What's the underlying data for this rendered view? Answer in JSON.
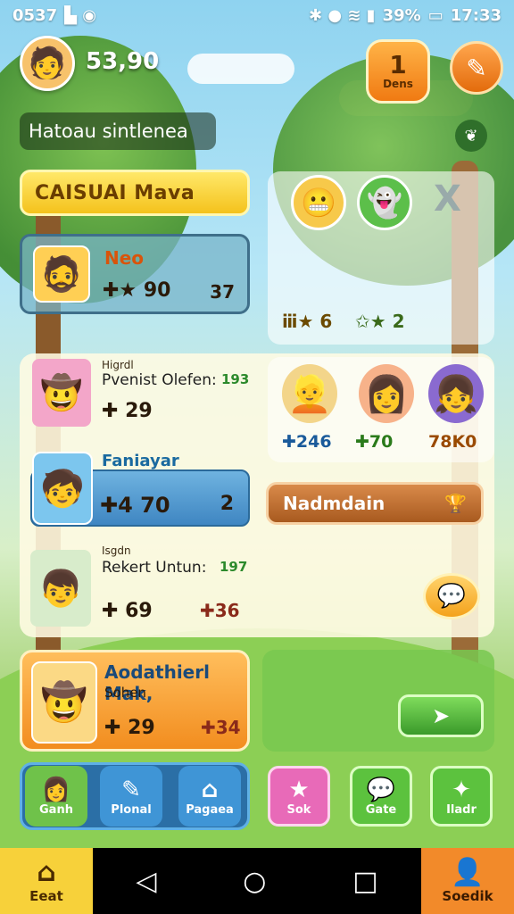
{
  "status_bar": {
    "time_left": "0537",
    "right_icons": "✱ ● ≋ ▮",
    "battery": "39%",
    "clock": "17:33"
  },
  "header": {
    "coins": "53,90",
    "badge_number": "1",
    "badge_label": "Dens",
    "banner": "Hatoau sintlenea"
  },
  "section": {
    "title": "CAISUAI Mava"
  },
  "card_a": {
    "name": "Neo",
    "score": "✚★ 90",
    "rank": "37"
  },
  "panel_r1": {
    "stat1": "ⅲ★ 6",
    "stat2": "✩★ 2",
    "close": "X"
  },
  "row_b": {
    "tag": "Higrdl",
    "title": "Pvenist Olefen:",
    "level": "193",
    "score": "✚ 29"
  },
  "characters": [
    {
      "score": "✚246"
    },
    {
      "score": "✚70"
    },
    {
      "score": "78K0"
    }
  ],
  "card_c": {
    "header": "Faniayar",
    "score": "✚4 70",
    "rank": "2"
  },
  "action_bar": {
    "label": "Nadmdain"
  },
  "row_d": {
    "tag": "Isgdn",
    "title": "Rekert Untun:",
    "level": "197",
    "score": "✚ 69",
    "score2": "✚36"
  },
  "card_e": {
    "title": "Aodathierl Mak,",
    "sub": "Sohen",
    "score": "✚ 29",
    "score2": "✚34"
  },
  "nav": [
    {
      "label": "Ganh"
    },
    {
      "label": "Plonal"
    },
    {
      "label": "Pagaea"
    },
    {
      "label": "Sok"
    },
    {
      "label": "Gate"
    },
    {
      "label": "Iladr"
    }
  ],
  "bottom": {
    "home_label": "Eeat",
    "profile_label": "Soedik"
  },
  "colors": {
    "accent": "#f4c21c",
    "panel": "#fffbe2",
    "nav_blue": "#2b6fa6",
    "home_tab": "#f7d13a",
    "profile_tab": "#f28a2a"
  }
}
